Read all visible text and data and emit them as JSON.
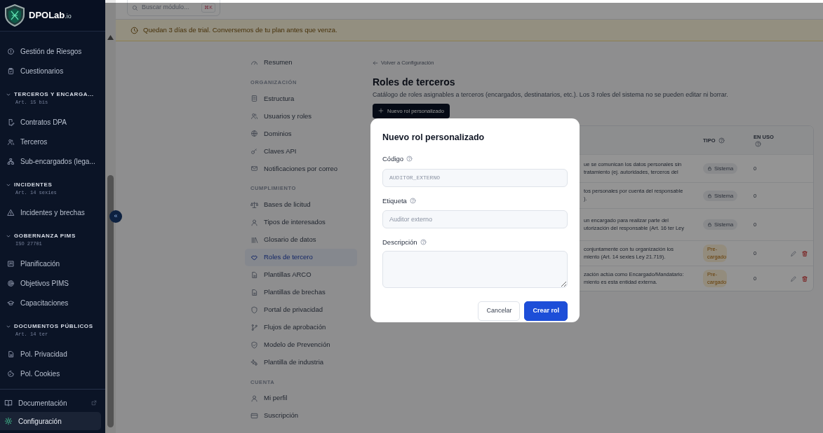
{
  "brand": {
    "name": "DPOLab",
    "suffix": ".io"
  },
  "sidebar": {
    "items": [
      {
        "kind": "item",
        "label": "Gestión de Riesgos"
      },
      {
        "kind": "item",
        "label": "Cuestionarios"
      },
      {
        "kind": "section",
        "label": "TERCEROS Y ENCARGA...",
        "subtitle": "Art. 15 bis",
        "expanded": true
      },
      {
        "kind": "item",
        "label": "Contratos DPA"
      },
      {
        "kind": "item",
        "label": "Terceros"
      },
      {
        "kind": "item",
        "label": "Sub-encargados (lega..."
      },
      {
        "kind": "section",
        "label": "INCIDENTES",
        "subtitle": "Art. 14 sexies",
        "expanded": true
      },
      {
        "kind": "item",
        "label": "Incidentes y brechas"
      },
      {
        "kind": "section",
        "label": "GOBERNANZA PIMS",
        "subtitle": "ISO 27701",
        "expanded": true
      },
      {
        "kind": "item",
        "label": "Planificación"
      },
      {
        "kind": "item",
        "label": "Objetivos PIMS"
      },
      {
        "kind": "item",
        "label": "Capacitaciones"
      },
      {
        "kind": "section",
        "label": "DOCUMENTOS PÚBLICOS",
        "subtitle": "Art. 14 ter",
        "expanded": true
      },
      {
        "kind": "item",
        "label": "Pol. Privacidad"
      },
      {
        "kind": "item",
        "label": "Pol. Cookies"
      }
    ],
    "footer": [
      {
        "label": "Documentación",
        "external": true,
        "selected": false
      },
      {
        "label": "Configuración",
        "external": false,
        "selected": true
      }
    ]
  },
  "collapse_button": "«",
  "search": {
    "placeholder": "Buscar módulo...",
    "shortcut": "⌘K"
  },
  "banner": {
    "text": "Quedan 3 días de trial. Conversemos de tu plan antes que venza."
  },
  "settings_nav": [
    {
      "kind": "item",
      "label": "Resumen",
      "selected": false
    },
    {
      "kind": "heading",
      "label": "ORGANIZACIÓN"
    },
    {
      "kind": "item",
      "label": "Estructura",
      "selected": false
    },
    {
      "kind": "item",
      "label": "Usuarios y roles",
      "selected": false
    },
    {
      "kind": "item",
      "label": "Dominios",
      "selected": false
    },
    {
      "kind": "item",
      "label": "Claves API",
      "selected": false
    },
    {
      "kind": "item",
      "label": "Notificaciones por correo",
      "selected": false
    },
    {
      "kind": "heading",
      "label": "CUMPLIMIENTO"
    },
    {
      "kind": "item",
      "label": "Bases de licitud",
      "selected": false
    },
    {
      "kind": "item",
      "label": "Tipos de interesados",
      "selected": false
    },
    {
      "kind": "item",
      "label": "Glosario de datos",
      "selected": false
    },
    {
      "kind": "item",
      "label": "Roles de tercero",
      "selected": true
    },
    {
      "kind": "item",
      "label": "Plantillas ARCO",
      "selected": false
    },
    {
      "kind": "item",
      "label": "Plantillas de brechas",
      "selected": false
    },
    {
      "kind": "item",
      "label": "Portal de privacidad",
      "selected": false
    },
    {
      "kind": "item",
      "label": "Flujos de aprobación",
      "selected": false
    },
    {
      "kind": "item",
      "label": "Modelo de Prevención",
      "selected": false
    },
    {
      "kind": "item",
      "label": "Plantilla de industria",
      "selected": false
    },
    {
      "kind": "heading",
      "label": "CUENTA"
    },
    {
      "kind": "item",
      "label": "Mi perfil",
      "selected": false
    },
    {
      "kind": "item",
      "label": "Suscripción",
      "selected": false
    }
  ],
  "page": {
    "back_link": "Volver a Configuración",
    "title": "Roles de terceros",
    "subtitle": "Catálogo de roles asignables a terceros (encargados, destinatarios, etc.). Los 3 roles del sistema no se pueden editar ni borrar.",
    "new_button": "Nuevo rol personalizado"
  },
  "table": {
    "columns": [
      {
        "label": "TIPO"
      },
      {
        "label": "EN USO"
      }
    ],
    "rows": [
      {
        "description": "ue se comunican los datos personales sin\ntratamiento (ej. autoridades, terceros del",
        "type": "Sistema",
        "kind": "system",
        "in_use": "0",
        "editable": false
      },
      {
        "description": "tos personales por cuenta del responsable\n).",
        "type": "Sistema",
        "kind": "system",
        "in_use": "0",
        "editable": false
      },
      {
        "description": "un encargado para realizar parte del\nutorización del responsable (Art. 16 ter Ley",
        "type": "Sistema",
        "kind": "system",
        "in_use": "0",
        "editable": false
      },
      {
        "description": "conjuntamente con tu organización los\nmiento (Art. 14 sexies Ley 21.719).",
        "type": "Pre-cargado",
        "kind": "preloaded",
        "in_use": "0",
        "editable": true
      },
      {
        "description": "zación actúa como Encargado/Mandatario:\nmiento es esta entidad externa.",
        "type": "Pre-cargado",
        "kind": "preloaded",
        "in_use": "0",
        "editable": true
      }
    ]
  },
  "modal": {
    "title": "Nuevo rol personalizado",
    "fields": [
      {
        "kind": "code",
        "label": "Código",
        "placeholder": "AUDITOR_EXTERNO"
      },
      {
        "kind": "text",
        "label": "Etiqueta",
        "placeholder": "Auditor externo"
      },
      {
        "kind": "textarea",
        "label": "Descripción"
      }
    ],
    "buttons": [
      {
        "kind": "secondary",
        "label": "Cancelar"
      },
      {
        "kind": "primary",
        "label": "Crear rol"
      }
    ]
  }
}
